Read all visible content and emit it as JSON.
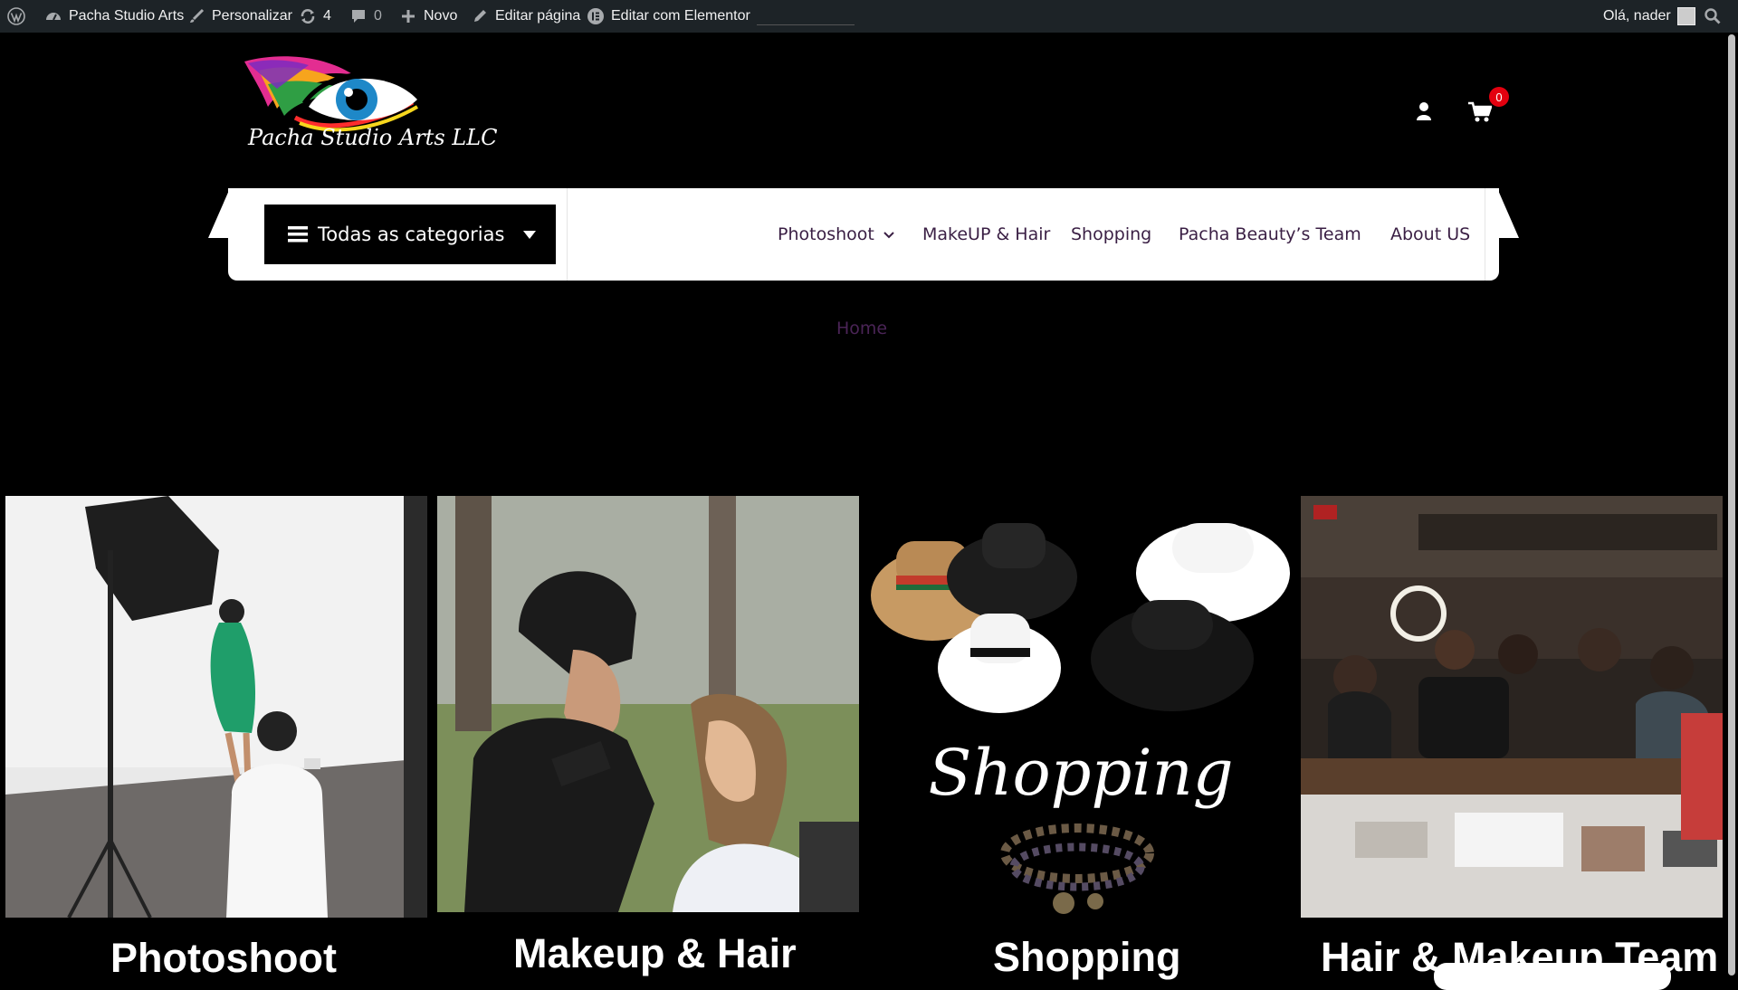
{
  "adminbar": {
    "wp_icon": "wordpress-icon",
    "site_name": "Pacha Studio Arts",
    "customize": "Personalizar",
    "updates_count": "4",
    "comments_count": "0",
    "new": "Novo",
    "edit_page": "Editar página",
    "edit_elementor": "Editar com Elementor",
    "greeting": "Olá, nader"
  },
  "header": {
    "logo_text": "Pacha Studio Arts LLC",
    "cart_count": "0"
  },
  "nav": {
    "categories_label": "Todas as categorias",
    "menu": [
      {
        "label": "Photoshoot"
      },
      {
        "label": "MakeUP & Hair"
      },
      {
        "label": "Shopping"
      },
      {
        "label": "Pacha Beauty’s Team"
      },
      {
        "label": "About US"
      }
    ]
  },
  "breadcrumb": {
    "home": "Home"
  },
  "cards": [
    {
      "title": "Photoshoot"
    },
    {
      "title": "Makeup & Hair"
    },
    {
      "title": "Shopping",
      "image_script": "Shopping"
    },
    {
      "title": "Hair & Makeup Team"
    }
  ],
  "colors": {
    "adminbar": "#1d2327",
    "background": "#000000",
    "menu_text": "#3a1f44",
    "cart_badge": "#e3000f"
  }
}
